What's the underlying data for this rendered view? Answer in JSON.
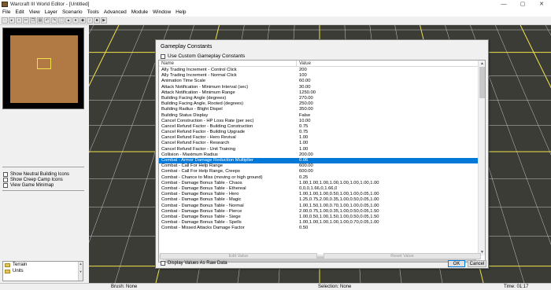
{
  "window": {
    "title": "Warcraft III World Editor - [Untitled]",
    "minimize": "—",
    "maximize": "▢",
    "close": "✕"
  },
  "menu": [
    "File",
    "Edit",
    "View",
    "Layer",
    "Scenario",
    "Tools",
    "Advanced",
    "Module",
    "Window",
    "Help"
  ],
  "left_panel": {
    "options": [
      "Show Neutral Building Icons",
      "Show Creep Camp Icons",
      "View Game Minimap"
    ],
    "palette_items": [
      "Terrain",
      "Units"
    ]
  },
  "dialog": {
    "title": "Gameplay Constants",
    "use_custom_label": "Use Custom Gameplay Constants",
    "columns": {
      "name": "Name",
      "value": "Value"
    },
    "rows": [
      {
        "name": "Ally Trading Increment - Control Click",
        "value": "200"
      },
      {
        "name": "Ally Trading Increment - Normal Click",
        "value": "100"
      },
      {
        "name": "Animation Time Scale",
        "value": "60.00"
      },
      {
        "name": "Attack Notification - Minimum Interval (sec)",
        "value": "30.00"
      },
      {
        "name": "Attack Notification - Minimum Range",
        "value": "1250.00"
      },
      {
        "name": "Building Facing Angle (degrees)",
        "value": "270.00"
      },
      {
        "name": "Building Facing Angle, Rooted (degrees)",
        "value": "250.00"
      },
      {
        "name": "Building Radius - Blight Dispel",
        "value": "350.00"
      },
      {
        "name": "Building Status Display",
        "value": "False"
      },
      {
        "name": "Cancel Construction - HP Loss Rate (per sec)",
        "value": "10.00"
      },
      {
        "name": "Cancel Refund Factor - Building Construction",
        "value": "0.75"
      },
      {
        "name": "Cancel Refund Factor - Building Upgrade",
        "value": "0.75"
      },
      {
        "name": "Cancel Refund Factor - Hero Revival",
        "value": "1.00"
      },
      {
        "name": "Cancel Refund Factor - Research",
        "value": "1.00"
      },
      {
        "name": "Cancel Refund Factor - Unit Training",
        "value": "1.00"
      },
      {
        "name": "Collision - Maximum Radius",
        "value": "200.00"
      },
      {
        "name": "Combat - Armor Damage Reduction Multiplier",
        "value": "0.06"
      },
      {
        "name": "Combat - Call For Help Range",
        "value": "600.00"
      },
      {
        "name": "Combat - Call For Help Range, Creeps",
        "value": "600.00"
      },
      {
        "name": "Combat - Chance to Miss (moving or high ground)",
        "value": "0.25"
      },
      {
        "name": "Combat - Damage Bonus Table - Chaos",
        "value": "1.00,1.00,1.00,1.00,1.00,1.00,1.00,1.00"
      },
      {
        "name": "Combat - Damage Bonus Table - Ethereal",
        "value": "0,0,0,1.66,0,1.66,0"
      },
      {
        "name": "Combat - Damage Bonus Table - Hero",
        "value": "1.00,1.00,1.00,0.50,1.00,1.00,0.05,1.00"
      },
      {
        "name": "Combat - Damage Bonus Table - Magic",
        "value": "1.25,0.75,2.00,0.35,1.00,0.50,0.05,1.00"
      },
      {
        "name": "Combat - Damage Bonus Table - Normal",
        "value": "1.00,1.50,1.00,0.70,1.00,1.00,0.05,1.00"
      },
      {
        "name": "Combat - Damage Bonus Table - Pierce",
        "value": "2.00,0.75,1.00,0.35,1.00,0.50,0.05,1.50"
      },
      {
        "name": "Combat - Damage Bonus Table - Siege",
        "value": "1.00,0.50,1.00,1.50,1.00,0.50,0.05,1.50"
      },
      {
        "name": "Combat - Damage Bonus Table - Spells",
        "value": "1.00,1.00,1.00,1.00,1.00,0.70,0.05,1.00"
      },
      {
        "name": "Combat - Missed Attacks Damage Factor",
        "value": "0.50"
      }
    ],
    "selected_index": 16,
    "edit_value_label": "Edit Value",
    "reset_value_label": "Reset Value",
    "raw_data_label": "Display Values As Raw Data",
    "ok_label": "OK",
    "cancel_label": "Cancel"
  },
  "status": {
    "brush": "Brush: None",
    "selection": "Selection: None",
    "time": "Time: 01:17"
  },
  "colors": {
    "grid_yellow": "#f2e24a",
    "grid_white": "#c9c9c9",
    "selection": "#0078d7",
    "terrain": "#3b3c36"
  }
}
